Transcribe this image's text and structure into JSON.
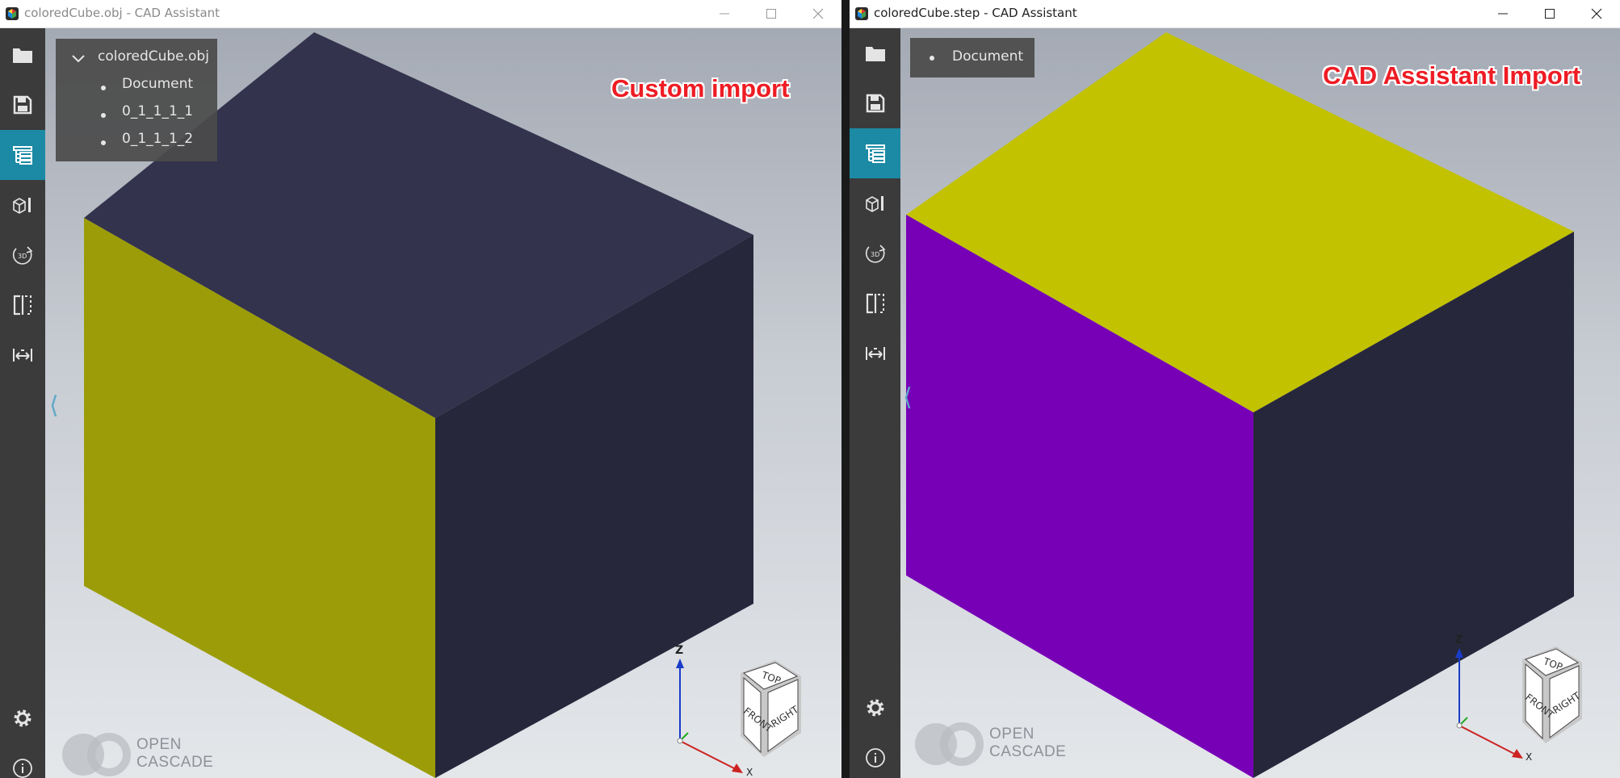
{
  "windows": [
    {
      "title": "coloredCube.obj - CAD Assistant",
      "tree": {
        "root_label": "coloredCube.obj",
        "items": [
          "Document",
          "0_1_1_1_1",
          "0_1_1_1_2"
        ]
      },
      "annotation": "Custom import",
      "brand": {
        "line1": "OPEN",
        "line2": "CASCADE"
      },
      "cube_colors": {
        "top": "#33334d",
        "left": "#9c9c08",
        "right": "#27273c"
      },
      "viewcube": {
        "top": "TOP",
        "front": "FRONT",
        "right": "RIGHT",
        "axis_z": "Z",
        "axis_x": "X"
      }
    },
    {
      "title": "coloredCube.step - CAD Assistant",
      "tree": {
        "items": [
          "Document"
        ]
      },
      "annotation": "CAD Assistant Import",
      "brand": {
        "line1": "OPEN",
        "line2": "CASCADE"
      },
      "cube_colors": {
        "top": "#c2c200",
        "left": "#7700b6",
        "right": "#27273c"
      },
      "viewcube": {
        "top": "TOP",
        "front": "FRONT",
        "right": "RIGHT",
        "axis_z": "Z",
        "axis_x": "X"
      }
    }
  ],
  "sidebar_tools": [
    "folder-icon",
    "save-icon",
    "model-tree-icon",
    "display-mode-icon",
    "view-3d-icon",
    "section-icon",
    "measure-icon",
    "settings-icon",
    "info-icon"
  ],
  "accent_color": "#1c8aa5"
}
